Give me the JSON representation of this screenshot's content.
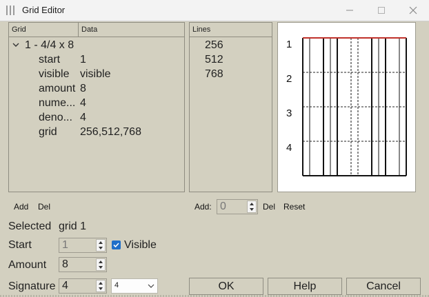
{
  "window": {
    "title": "Grid Editor",
    "minimize_icon": "minimize-icon",
    "maximize_icon": "maximize-icon",
    "close_icon": "close-icon"
  },
  "tree": {
    "headers": {
      "grid": "Grid",
      "data": "Data"
    },
    "root": {
      "label": "1 - 4/4 x 8",
      "expanded": true
    },
    "rows": [
      {
        "key": "start",
        "value": "1"
      },
      {
        "key": "visible",
        "value": "visible"
      },
      {
        "key": "amount",
        "value": "8"
      },
      {
        "key": "nume...",
        "value": "4"
      },
      {
        "key": "deno...",
        "value": "4"
      },
      {
        "key": "grid",
        "value": "256,512,768"
      }
    ],
    "add_label": "Add",
    "del_label": "Del"
  },
  "lines": {
    "header": "Lines",
    "items": [
      "256",
      "512",
      "768"
    ],
    "add_label": "Add:",
    "add_value": "0",
    "del_label": "Del",
    "reset_label": "Reset"
  },
  "preview": {
    "row_labels": [
      "1",
      "2",
      "3",
      "4"
    ],
    "accent_color": "#c0302a"
  },
  "form": {
    "selected_label": "Selected",
    "selected_value": "grid 1",
    "start_label": "Start",
    "start_value": "1",
    "visible_label": "Visible",
    "visible_checked": true,
    "amount_label": "Amount",
    "amount_value": "8",
    "signature_label": "Signature",
    "signature_value": "4",
    "denominator_value": "4"
  },
  "buttons": {
    "ok": "OK",
    "help": "Help",
    "cancel": "Cancel"
  }
}
